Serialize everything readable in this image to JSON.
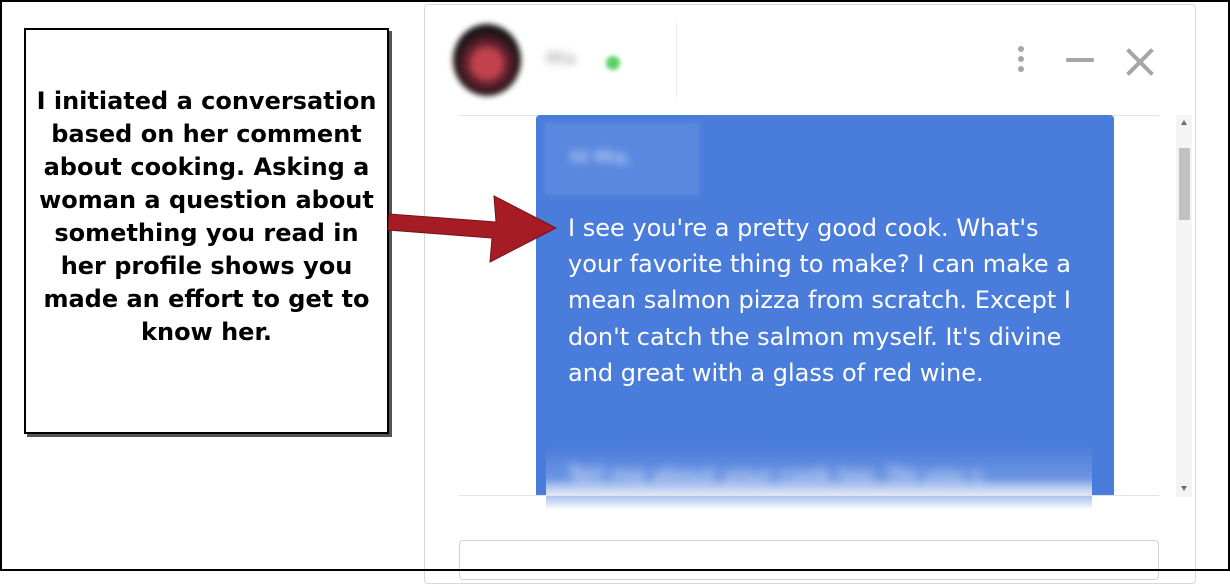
{
  "annotation": {
    "text": "I initiated a conversation based on her comment about cooking.   Asking a woman a question about something you read in her profile shows you made an effort to get to know her."
  },
  "chat": {
    "contact_name": "Mia",
    "online_status_color": "#59d168",
    "icons": {
      "menu": "more-vertical-icon",
      "minimize": "minimize-icon",
      "close": "close-icon"
    },
    "message": {
      "greeting": "Hi Mia,",
      "body": "I see you're a pretty good cook.  What's your favorite thing to make?  I can make a mean salmon pizza from scratch. Except I don't catch the salmon myself. It's divine and great with a glass of red wine.",
      "next_line": "Tell me about your cook too. Do you c"
    },
    "colors": {
      "bubble": "#4a7cdb",
      "arrow": "#a51c24"
    }
  }
}
